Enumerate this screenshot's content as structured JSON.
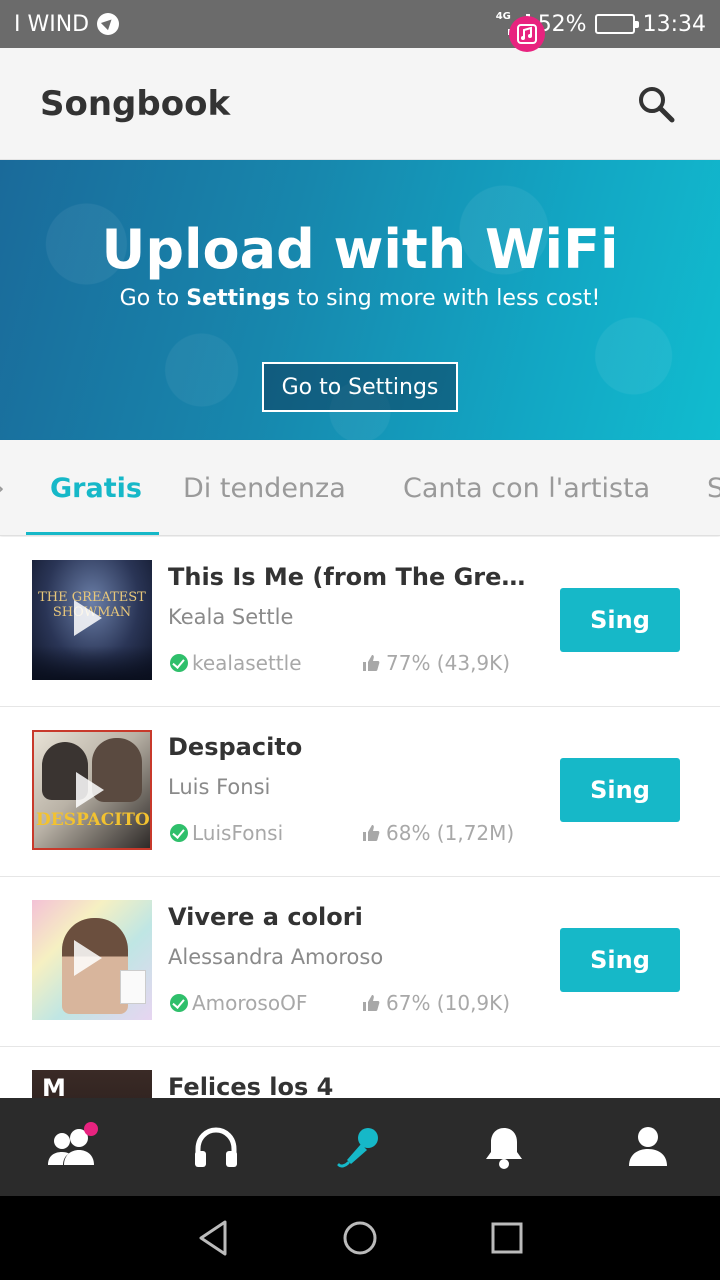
{
  "status_bar": {
    "carrier": "I WIND",
    "network": "4G",
    "battery": "52%",
    "battery_level": 0.52,
    "time": "13:34"
  },
  "app_bar": {
    "title": "Songbook"
  },
  "banner": {
    "title": "Upload with WiFi",
    "subtitle_prefix": "Go to ",
    "subtitle_bold": "Settings",
    "subtitle_suffix": " to sing more with less cost!",
    "button_label": "Go to Settings"
  },
  "tabs": [
    {
      "label": "Gratis",
      "active": true
    },
    {
      "label": "Di tendenza",
      "active": false
    },
    {
      "label": "Canta con l'artista",
      "active": false
    },
    {
      "label": "S",
      "active": false
    }
  ],
  "songs": [
    {
      "title": "This Is Me (from The Greate...",
      "artist": "Keala Settle",
      "user": "kealasettle",
      "stats": "77% (43,9K)",
      "cover_text": "THE GREATEST SHOWMAN",
      "sing_label": "Sing"
    },
    {
      "title": "Despacito",
      "artist": "Luis Fonsi",
      "user": "LuisFonsi",
      "stats": "68% (1,72M)",
      "cover_text": "DESPACITO",
      "sing_label": "Sing"
    },
    {
      "title": "Vivere a colori",
      "artist": "Alessandra Amoroso",
      "user": "AmorosoOF",
      "stats": "67% (10,9K)",
      "cover_text": "",
      "sing_label": "Sing"
    },
    {
      "title": "Felices los 4",
      "artist": "",
      "user": "",
      "stats": "",
      "cover_text": "M",
      "sing_label": ""
    }
  ],
  "bottom_nav": [
    {
      "icon": "friends-icon",
      "active": false
    },
    {
      "icon": "headphones-icon",
      "active": false
    },
    {
      "icon": "microphone-icon",
      "active": true
    },
    {
      "icon": "bell-icon",
      "active": false
    },
    {
      "icon": "profile-icon",
      "active": false
    }
  ],
  "colors": {
    "accent": "#16b8c8",
    "badge": "#e8237f",
    "nav_bg": "#2b2b2b"
  }
}
